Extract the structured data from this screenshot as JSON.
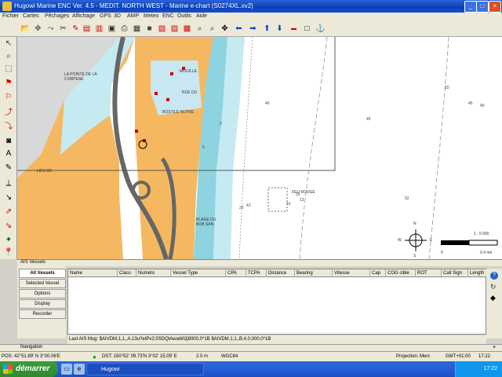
{
  "window": {
    "title": "Hugowi Marine ENC Ver. 4.5 - MEDIT. NORTH WEST - Marine e-chart  (S0274XL.xv2)"
  },
  "menu": [
    "Fichier",
    "Cartes",
    "Pêchages",
    "Affichage",
    "GPS",
    "3D",
    "AMP",
    "Meteo",
    "ENC",
    "Outils",
    "Aide"
  ],
  "map": {
    "labels": {
      "pointe": "LA POINTE DE LA CORPESE",
      "mouille": "MOUILLE",
      "rue": "RUE DU",
      "centre": "BOSTILE NOTRE",
      "lieu": "LIEU DE",
      "plage": "PLAGE DU\nBOB SAN",
      "feu": "FEU ROUGE"
    },
    "depths": [
      "40",
      "45",
      "3",
      "10",
      "45",
      "40",
      "5",
      "4",
      "10",
      "23",
      "52",
      "15",
      "13",
      "2"
    ],
    "compass": {
      "n": "N",
      "s": "S",
      "e": "E",
      "w": "W"
    },
    "scale": {
      "ratio": "1 : 5 000",
      "start": "0",
      "end": "0.4 nm"
    }
  },
  "ais": {
    "header": "AIS Vessels",
    "buttons": [
      "All Vessels",
      "Selected Vessel",
      "Options",
      "Display",
      "Recorder"
    ],
    "columns": [
      "Name",
      "Class",
      "Numéro",
      "Vessel Type",
      "CPA",
      "TCPA",
      "Distance",
      "Bearing",
      "Vitesse",
      "Cap",
      "COG cible",
      "ROT",
      "Call Sign",
      "Length"
    ],
    "message": "Last AIS Msg:  $AIVDM,1,1,,A,13u?etPv2;0SDQtAwaWl2j8000,0*1B   $AIVDM,1,1,,B,4,0,000,0*1B"
  },
  "navigation": {
    "label": "Navigation"
  },
  "status": {
    "position": "POS: 42°51.89' N  3°00.06'E",
    "dest": "DST: 150°52' 09.73'N  3°02' 15.09' E",
    "dist": "2.0 m",
    "datum": "WGC84",
    "projection": "Projection: Merc",
    "time": "GMT+01:00",
    "clock": "17:22"
  },
  "taskbar": {
    "start": "démarrer",
    "task": "Hugowi",
    "tray_time": "17:22"
  }
}
